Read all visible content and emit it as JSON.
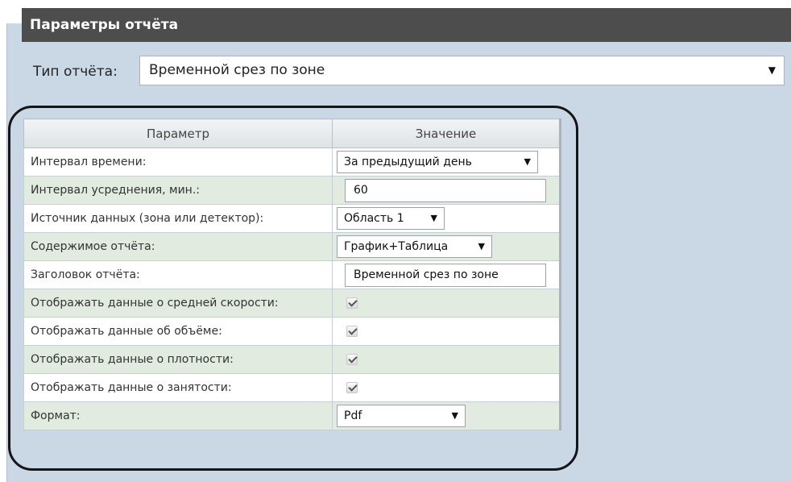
{
  "panel": {
    "title": "Параметры отчёта"
  },
  "report_type": {
    "label": "Тип отчёта:",
    "value": "Временной срез по зоне"
  },
  "table": {
    "headers": {
      "param": "Параметр",
      "value": "Значение"
    },
    "rows": [
      {
        "label": "Интервал времени:",
        "kind": "select",
        "value": "За предыдущий день"
      },
      {
        "label": "Интервал усреднения, мин.:",
        "kind": "input",
        "value": "60"
      },
      {
        "label": "Источник данных (зона или детектор):",
        "kind": "select",
        "value": "Область 1"
      },
      {
        "label": "Содержимое отчёта:",
        "kind": "select",
        "value": "График+Таблица"
      },
      {
        "label": "Заголовок отчёта:",
        "kind": "input",
        "value": "Временной срез по зоне"
      },
      {
        "label": "Отображать данные о средней скорости:",
        "kind": "checkbox",
        "checked": true
      },
      {
        "label": "Отображать данные об объёме:",
        "kind": "checkbox",
        "checked": true
      },
      {
        "label": "Отображать данные о плотности:",
        "kind": "checkbox",
        "checked": true
      },
      {
        "label": "Отображать данные о занятости:",
        "kind": "checkbox",
        "checked": true
      },
      {
        "label": "Формат:",
        "kind": "select",
        "value": "Pdf"
      }
    ]
  },
  "icons": {
    "dropdown": "dropdown-arrow-icon",
    "checkbox": "checkmark-icon"
  },
  "colors": {
    "title_bar": "#4d4d4d",
    "panel_bg": "#cad8e6",
    "row_alt": "#e1ebdf",
    "outline": "#151515"
  }
}
